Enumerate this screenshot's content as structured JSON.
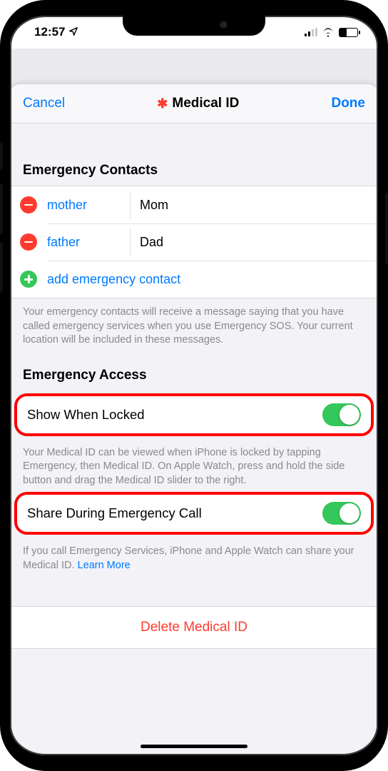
{
  "status": {
    "time": "12:57"
  },
  "header": {
    "cancel": "Cancel",
    "title": "Medical ID",
    "done": "Done"
  },
  "sections": {
    "contacts": {
      "title": "Emergency Contacts",
      "items": [
        {
          "relation": "mother",
          "name": "Mom"
        },
        {
          "relation": "father",
          "name": "Dad"
        }
      ],
      "add_label": "add emergency contact",
      "footer": "Your emergency contacts will receive a message saying that you have called emergency services when you use Emergency SOS. Your current location will be included in these messages."
    },
    "access": {
      "title": "Emergency Access",
      "show_locked_label": "Show When Locked",
      "show_locked_footer": "Your Medical ID can be viewed when iPhone is locked by tapping Emergency, then Medical ID. On Apple Watch, press and hold the side button and drag the Medical ID slider to the right.",
      "share_call_label": "Share During Emergency Call",
      "share_call_footer_pre": "If you call Emergency Services, iPhone and Apple Watch can share your Medical ID. ",
      "share_call_learn": "Learn More"
    }
  },
  "delete_label": "Delete Medical ID"
}
